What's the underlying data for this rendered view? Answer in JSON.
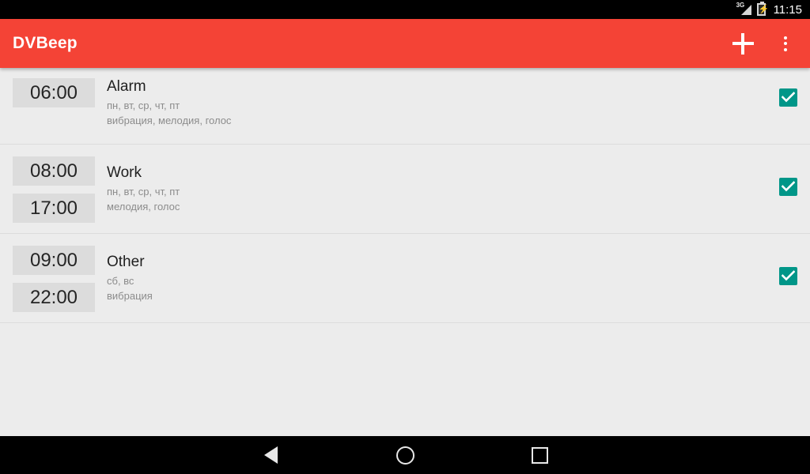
{
  "status_bar": {
    "signal_icon": "3g-signal-icon",
    "signal_label": "3G",
    "battery_icon": "battery-charging-icon",
    "clock": "11:15"
  },
  "app_bar": {
    "title": "DVBeep",
    "add_icon": "plus-icon",
    "overflow_icon": "overflow-menu-icon",
    "background_color": "#f44336"
  },
  "theme": {
    "accent_color": "#f44336",
    "checkbox_color": "#009688",
    "page_background": "#ececec",
    "badge_background": "#dcdcdc"
  },
  "alarms": [
    {
      "times": [
        "06:00"
      ],
      "title": "Alarm",
      "days": "пн, вт, ср, чт, пт",
      "modes": "вибрация, мелодия, голос",
      "enabled": true
    },
    {
      "times": [
        "08:00",
        "17:00"
      ],
      "title": "Work",
      "days": "пн, вт, ср, чт, пт",
      "modes": "мелодия, голос",
      "enabled": true
    },
    {
      "times": [
        "09:00",
        "22:00"
      ],
      "title": "Other",
      "days": "сб, вс",
      "modes": "вибрация",
      "enabled": true
    }
  ],
  "nav_bar": {
    "back_icon": "back-triangle-icon",
    "home_icon": "home-circle-icon",
    "recents_icon": "recents-square-icon"
  }
}
